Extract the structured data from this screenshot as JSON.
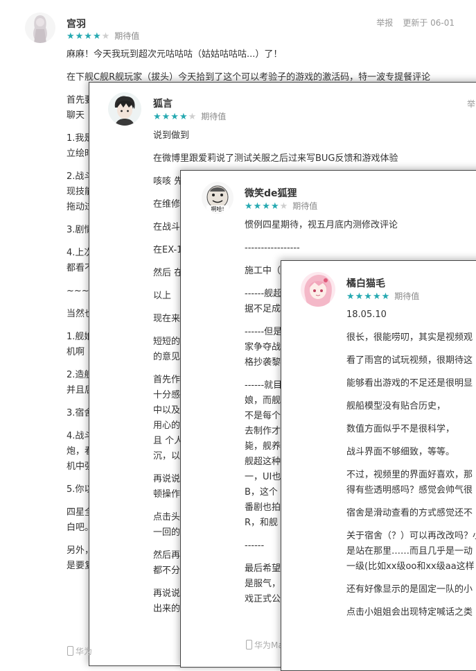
{
  "reviews": [
    {
      "user": "宫羽",
      "rating": 4,
      "tag": "期待值",
      "report": "举报",
      "updated": "更新于 06-01",
      "paragraphs": [
        "麻麻！今天我玩到超次元咕咕咕（姑姑咕咕咕...）了！",
        "在下舰C舰R舰玩家（拔头）今天拾到了这个可以考验子的游戏的激活码，特一波专提餐评论",
        "首先要\n聊天",
        "1.我是\n立绘时",
        "2.战斗\n现技能\n拖动过",
        "3.剧情",
        "4.上次\n都看不",
        "~~~~~",
        "当然也",
        "1.舰娘\n机啊",
        "2.造舰\n并且后",
        "3.宿舍",
        "4.战斗\n炮，看\n机中强",
        "5.你以",
        "四星全\n白吧。",
        "另外，\n是要复"
      ]
    },
    {
      "user": "狐言",
      "rating": 4,
      "tag": "期待值",
      "report": "举",
      "paragraphs": [
        "说到做到",
        "在微博里跟爱莉说了测试关服之后过来写BUG反馈和游戏体验",
        "咳咳 先",
        "在维修",
        "在战斗",
        "在EX-1",
        "然后 在",
        "以上",
        "现在来",
        "短短的\n的意见",
        "首先作\n十分感\n中以及\n用心的\n且 个人\n沉，以",
        "再说说\n顿操作",
        "点击头\n一回的",
        "然后再\n都不分",
        "再说说\n出来的"
      ],
      "footer": "华为"
    },
    {
      "user": "微笑de狐狸",
      "rating": 4,
      "tag": "期待值",
      "paragraphs": [
        "惯例四星期待，视五月底内测修改评论",
        "-----------------",
        "施工中（",
        "------舰超\n据不足成",
        "------但是\n家争夺战\n格抄袭黎",
        "------就目\n娘，而舰\n不是每个\n去制作才\n毙，舰养\n舰超这种\n一，UI也\nB，这个\n番剧也拍\nR，和舰",
        "------",
        "最后希望\n是服气，\n戏正式公"
      ],
      "footer": "华为Ma"
    },
    {
      "user": "橘白猫毛",
      "rating": 5,
      "tag": "期待值",
      "paragraphs": [
        "18.05.10",
        "很长，很能唠叨，其实是视频观",
        "看了雨宫的试玩视频，很期待这",
        "能够看出游戏的不足还是很明显",
        "舰船模型没有贴合历史，",
        "数值方面似乎不是很科学，",
        "战斗界面不够细致，等等。",
        "不过，视频里的界面好喜欢，那\n得有些透明感吗？感觉会帅气很",
        "宿舍是滑动查看的方式感觉还不",
        "关于宿舍（？）可以再改改吗？小\n是站在那里……而且几乎是一动\n一级(比如xx级oo和xx级aa这样",
        "还有好像显示的是固定一队的小",
        "点击小姐姐会出现特定喊话之类"
      ]
    }
  ]
}
